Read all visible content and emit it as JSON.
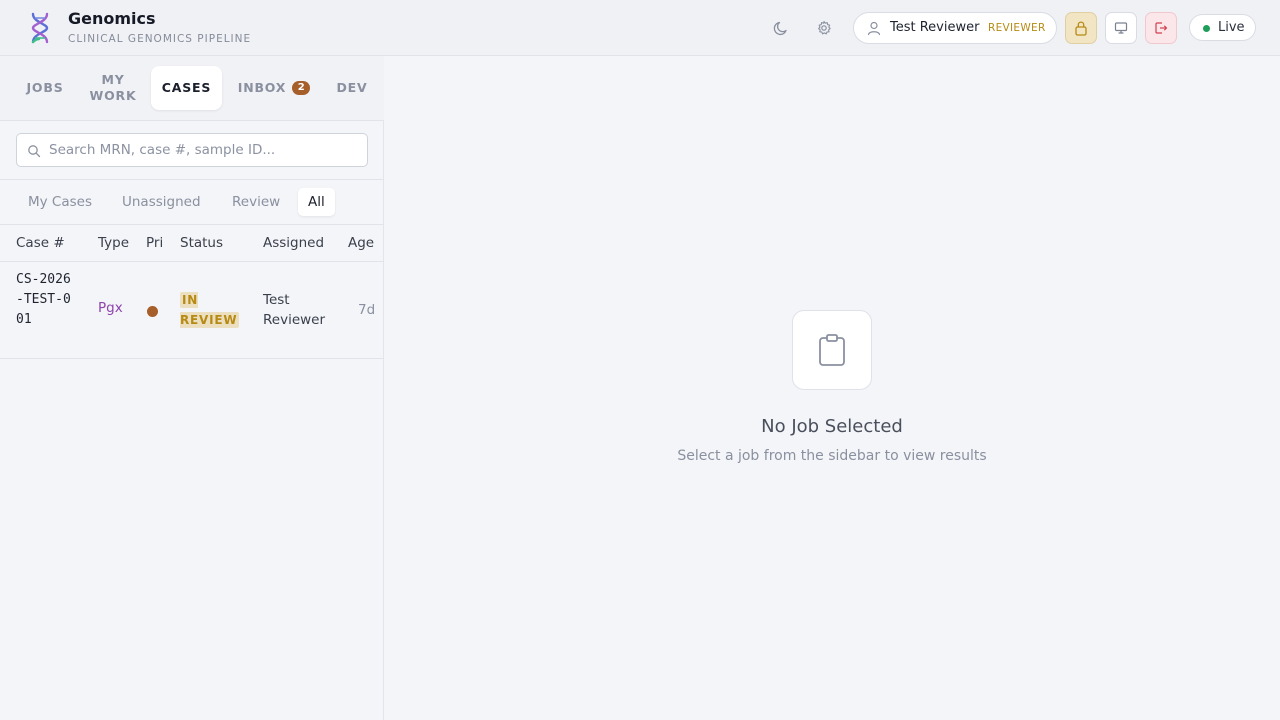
{
  "brand": {
    "title": "Genomics",
    "subtitle": "CLINICAL GENOMICS PIPELINE",
    "logo_icon": "dna-icon"
  },
  "header": {
    "theme_icon": "moon-icon",
    "settings_icon": "gear-icon",
    "user": {
      "name": "Test Reviewer",
      "role": "REVIEWER",
      "icon": "user-icon"
    },
    "lock_icon": "lock-icon",
    "monitor_icon": "monitor-icon",
    "logout_icon": "logout-icon",
    "status": {
      "label": "Live",
      "color": "#1f9d5a"
    }
  },
  "sidebar": {
    "tabs": [
      {
        "label": "JOBS"
      },
      {
        "label": "MY WORK"
      },
      {
        "label": "CASES",
        "active": true
      },
      {
        "label": "INBOX",
        "badge": "2"
      },
      {
        "label": "DEV"
      }
    ],
    "search": {
      "placeholder": "Search MRN, case #, sample ID...",
      "value": ""
    },
    "filters": [
      {
        "label": "My Cases"
      },
      {
        "label": "Unassigned"
      },
      {
        "label": "Review"
      },
      {
        "label": "All",
        "active": true
      }
    ],
    "table": {
      "columns": [
        "Case #",
        "Type",
        "Pri",
        "Status",
        "Assigned",
        "Age"
      ],
      "rows": [
        {
          "case": "CS-2026-TEST-001",
          "type": "Pgx",
          "priority_color": "#a65e2a",
          "status": "IN REVIEW",
          "assigned": "Test Reviewer",
          "age": "7d"
        }
      ]
    }
  },
  "main": {
    "empty_icon": "clipboard-icon",
    "empty_title": "No Job Selected",
    "empty_subtitle": "Select a job from the sidebar to view results"
  },
  "colors": {
    "accent_brown": "#a65e2a",
    "reviewer_gold": "#b78a14",
    "type_purple": "#8e44ad"
  }
}
